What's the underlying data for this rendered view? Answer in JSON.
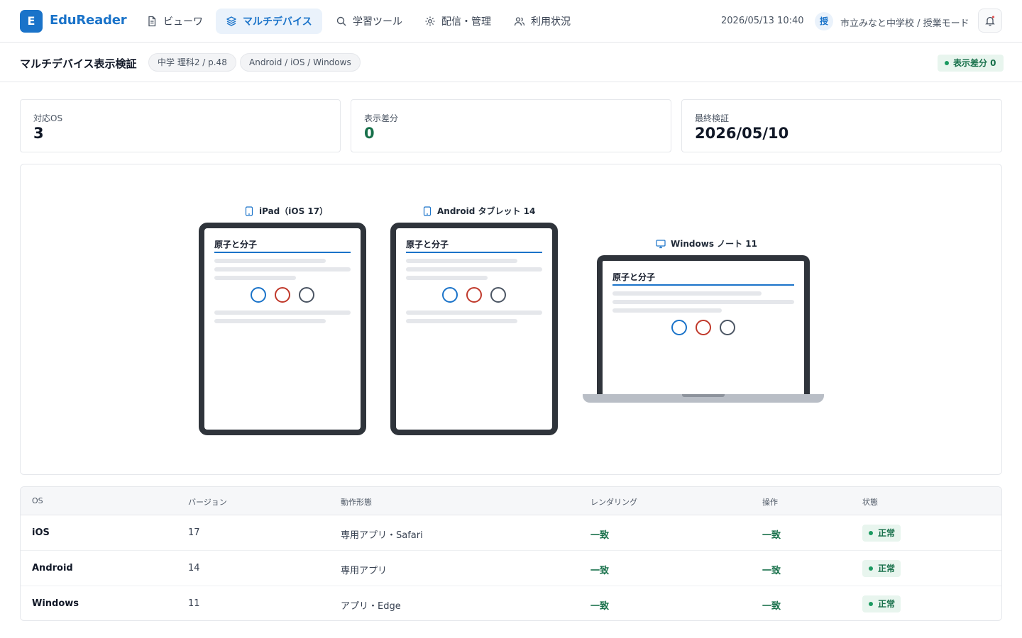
{
  "app": {
    "logo_letter": "E",
    "name": "EduReader"
  },
  "nav": {
    "items": [
      {
        "label": "ビューワ",
        "icon": "document-icon"
      },
      {
        "label": "マルチデバイス",
        "icon": "layers-icon",
        "active": true
      },
      {
        "label": "学習ツール",
        "icon": "search-icon"
      },
      {
        "label": "配信・管理",
        "icon": "gear-icon"
      },
      {
        "label": "利用状況",
        "icon": "users-icon"
      }
    ]
  },
  "header": {
    "datetime": "2026/05/13 10:40",
    "user_badge": "授",
    "user_label": "市立みなと中学校 / 授業モード"
  },
  "page": {
    "title": "マルチデバイス表示検証",
    "chips": [
      "中学 理科2 / p.48",
      "Android / iOS / Windows"
    ],
    "diff_badge": "表示差分 0"
  },
  "stats": [
    {
      "label": "対応OS",
      "value": "3"
    },
    {
      "label": "表示差分",
      "value": "0"
    },
    {
      "label": "最終検証",
      "value": "2026/05/10"
    }
  ],
  "devices": [
    {
      "caption": "iPad（iOS 17）",
      "screen_title": "原子と分子"
    },
    {
      "caption": "Android タブレット 14",
      "screen_title": "原子と分子"
    },
    {
      "caption": "Windows ノート 11",
      "screen_title": "原子と分子"
    }
  ],
  "table": {
    "headers": [
      "OS",
      "バージョン",
      "動作形態",
      "レンダリング",
      "操作",
      "状態"
    ],
    "rows": [
      {
        "os": "iOS",
        "version": "17",
        "mode": "専用アプリ・Safari",
        "rendering": "一致",
        "operation": "一致",
        "status": "正常"
      },
      {
        "os": "Android",
        "version": "14",
        "mode": "専用アプリ",
        "rendering": "一致",
        "operation": "一致",
        "status": "正常"
      },
      {
        "os": "Windows",
        "version": "11",
        "mode": "アプリ・Edge",
        "rendering": "一致",
        "operation": "一致",
        "status": "正常"
      }
    ]
  },
  "colors": {
    "accent": "#1a73c9",
    "success": "#17704a",
    "success_bg": "#e8f5ee",
    "device_frame": "#2f343b"
  }
}
